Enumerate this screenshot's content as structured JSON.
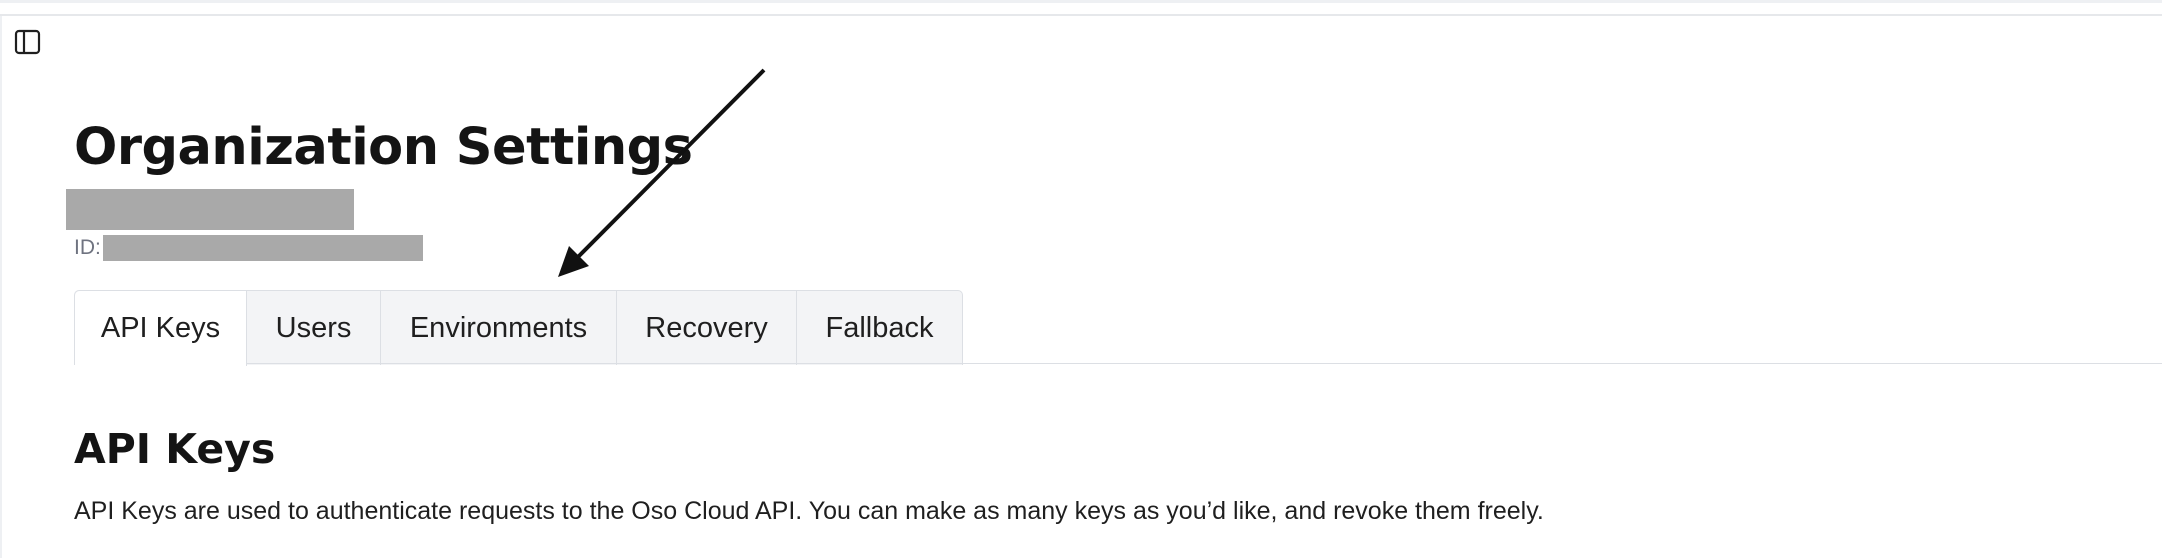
{
  "page": {
    "title": "Organization Settings",
    "org_id_label": "ID:"
  },
  "icons": {
    "sidebar_toggle": "sidebar-panel-icon"
  },
  "tabs": [
    {
      "label": "API Keys",
      "active": true
    },
    {
      "label": "Users",
      "active": false
    },
    {
      "label": "Environments",
      "active": false
    },
    {
      "label": "Recovery",
      "active": false
    },
    {
      "label": "Fallback",
      "active": false
    }
  ],
  "section": {
    "title": "API Keys",
    "description": "API Keys are used to authenticate requests to the Oso Cloud API. You can make as many keys as you’d like, and revoke them freely."
  },
  "colors": {
    "tab_bar_bg": "#f3f4f6",
    "active_tab_bg": "#ffffff",
    "border": "#dcdfe4",
    "redaction": "#a9a9a9",
    "muted_text": "#6f7380"
  }
}
